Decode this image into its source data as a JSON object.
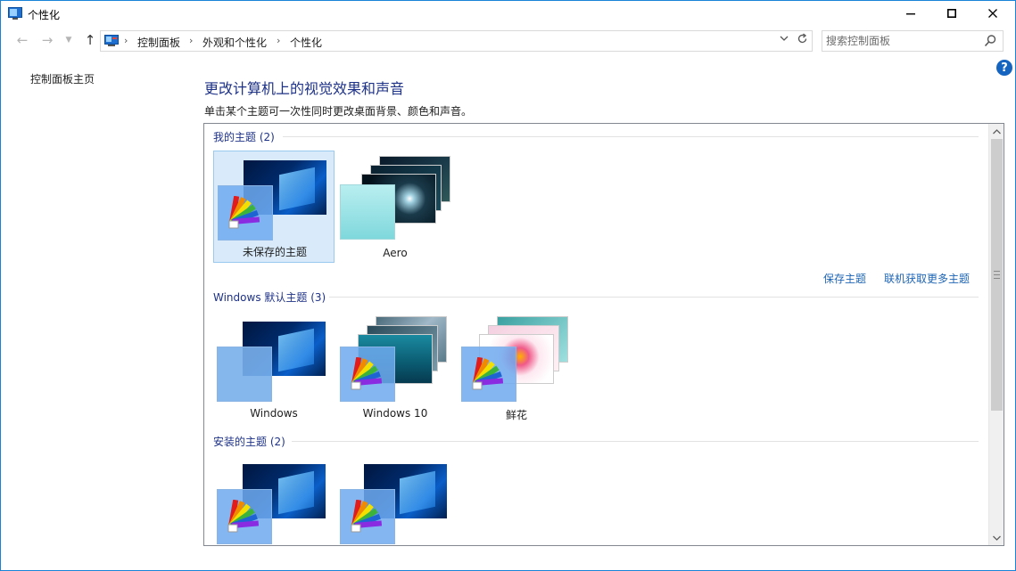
{
  "window": {
    "title": "个性化",
    "minimize_icon": "minimize-icon",
    "maximize_icon": "maximize-icon",
    "close_icon": "close-icon"
  },
  "address_bar": {
    "breadcrumbs": [
      "控制面板",
      "外观和个性化",
      "个性化"
    ],
    "separator": "›"
  },
  "search": {
    "placeholder": "搜索控制面板"
  },
  "left_panel": {
    "home_link": "控制面板主页"
  },
  "help": {
    "label": "?"
  },
  "main": {
    "heading": "更改计算机上的视觉效果和声音",
    "subtext": "单击某个主题可一次性同时更改桌面背景、颜色和声音。"
  },
  "themes": {
    "my_themes": {
      "title": "我的主题 (2)",
      "items": [
        {
          "label": "未保存的主题",
          "selected": true
        },
        {
          "label": "Aero",
          "selected": false
        }
      ],
      "save_link": "保存主题",
      "online_link": "联机获取更多主题"
    },
    "windows_default": {
      "title": "Windows 默认主题 (3)",
      "items": [
        {
          "label": "Windows"
        },
        {
          "label": "Windows 10"
        },
        {
          "label": "鲜花"
        }
      ]
    },
    "installed": {
      "title": "安装的主题 (2)",
      "items": [
        {
          "label": ""
        },
        {
          "label": ""
        }
      ]
    }
  },
  "colors": {
    "accent": "#1883d7",
    "heading": "#1e3287",
    "link": "#1e64b4",
    "selected_bg": "#d9ebfa"
  }
}
